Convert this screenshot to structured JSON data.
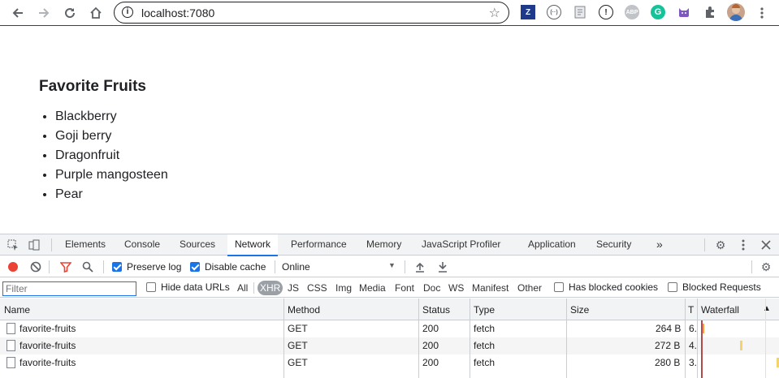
{
  "browser": {
    "url": "localhost:7080",
    "extensions": [
      "Z",
      "(··)",
      "",
      "",
      "ABP",
      "G",
      "",
      "",
      ""
    ]
  },
  "page": {
    "title": "Favorite Fruits",
    "fruits": [
      "Blackberry",
      "Goji berry",
      "Dragonfruit",
      "Purple mangosteen",
      "Pear"
    ]
  },
  "devtools": {
    "tabs": [
      "Elements",
      "Console",
      "Sources",
      "Network",
      "Performance",
      "Memory",
      "JavaScript Profiler",
      "Application",
      "Security"
    ],
    "more_tabs": "»",
    "controls": {
      "preserve_log": "Preserve log",
      "disable_cache": "Disable cache",
      "throttling": "Online"
    },
    "filter": {
      "placeholder": "Filter",
      "hide_data_urls": "Hide data URLs",
      "types": [
        "All",
        "XHR",
        "JS",
        "CSS",
        "Img",
        "Media",
        "Font",
        "Doc",
        "WS",
        "Manifest",
        "Other"
      ],
      "active_type": "XHR",
      "has_blocked_cookies": "Has blocked cookies",
      "blocked_requests": "Blocked Requests"
    },
    "columns": [
      "Name",
      "Method",
      "Status",
      "Type",
      "Size",
      "T",
      "Waterfall"
    ],
    "rows": [
      {
        "name": "favorite-fruits",
        "method": "GET",
        "status": "200",
        "type": "fetch",
        "size": "264 B",
        "time": "6."
      },
      {
        "name": "favorite-fruits",
        "method": "GET",
        "status": "200",
        "type": "fetch",
        "size": "272 B",
        "time": "4."
      },
      {
        "name": "favorite-fruits",
        "method": "GET",
        "status": "200",
        "type": "fetch",
        "size": "280 B",
        "time": "3."
      }
    ]
  }
}
